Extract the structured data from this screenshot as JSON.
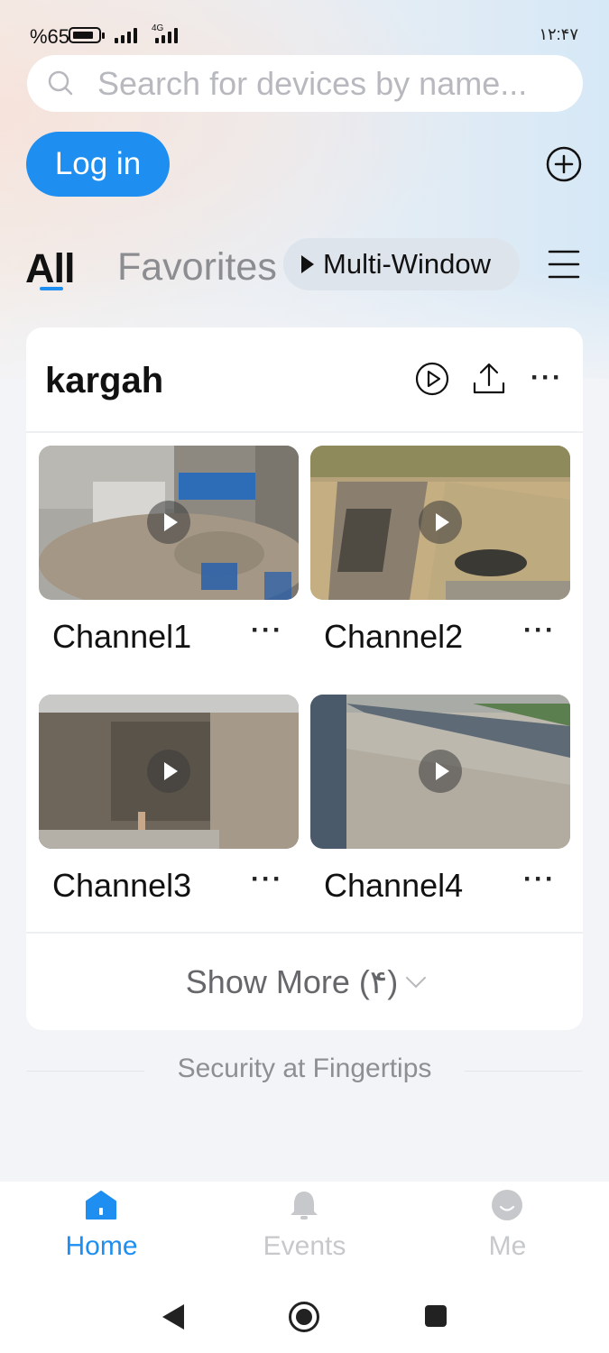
{
  "status_bar": {
    "battery_percent": "%65",
    "network_type": "4G",
    "time": "۱۲:۴۷"
  },
  "search": {
    "placeholder": "Search for devices by name..."
  },
  "header": {
    "login_label": "Log in"
  },
  "tabs": {
    "all_label": "All",
    "favorites_label": "Favorites",
    "multi_window_label": "Multi-Window"
  },
  "device": {
    "name": "kargah",
    "channels": [
      {
        "label": "Channel1",
        "more": "···"
      },
      {
        "label": "Channel2",
        "more": "···"
      },
      {
        "label": "Channel3",
        "more": "···"
      },
      {
        "label": "Channel4",
        "more": "···"
      }
    ],
    "more_menu": "···",
    "show_more_label": "Show More (۴)"
  },
  "tagline": "Security at Fingertips",
  "bottom_nav": {
    "items": [
      {
        "label": "Home",
        "icon": "home-icon",
        "active": true
      },
      {
        "label": "Events",
        "icon": "bell-icon",
        "active": false
      },
      {
        "label": "Me",
        "icon": "user-icon",
        "active": false
      }
    ]
  },
  "colors": {
    "accent": "#1e8ff0",
    "inactive_nav": "#c7c8cb",
    "text_primary": "#111111",
    "text_muted": "#8e8f93"
  }
}
